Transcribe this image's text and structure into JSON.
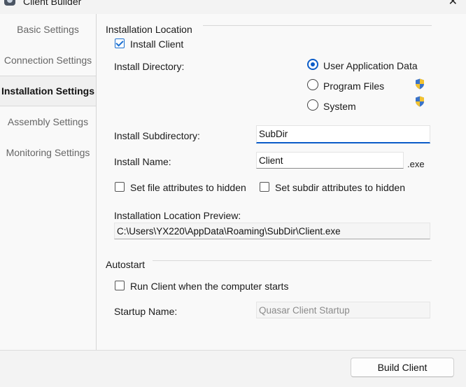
{
  "window": {
    "title": "Client Builder",
    "close_glyph": "✕"
  },
  "sidebar": {
    "items": [
      {
        "label": "Basic Settings"
      },
      {
        "label": "Connection Settings"
      },
      {
        "label": "Installation Settings",
        "active": true
      },
      {
        "label": "Assembly Settings"
      },
      {
        "label": "Monitoring Settings"
      }
    ]
  },
  "installation": {
    "group_title": "Installation Location",
    "install_client": {
      "label": "Install Client",
      "checked": true
    },
    "install_directory_label": "Install Directory:",
    "directory_options": [
      {
        "label": "User Application Data",
        "selected": true,
        "admin_shield": false
      },
      {
        "label": "Program Files",
        "selected": false,
        "admin_shield": true
      },
      {
        "label": "System",
        "selected": false,
        "admin_shield": true
      }
    ],
    "subdirectory": {
      "label": "Install Subdirectory:",
      "value": "SubDir"
    },
    "name": {
      "label": "Install Name:",
      "value": "Client",
      "suffix": ".exe"
    },
    "hide_file": {
      "label": "Set file attributes to hidden",
      "checked": false
    },
    "hide_subdir": {
      "label": "Set subdir attributes to hidden",
      "checked": false
    },
    "preview": {
      "label": "Installation Location Preview:",
      "value": "C:\\Users\\YX220\\AppData\\Roaming\\SubDir\\Client.exe"
    }
  },
  "autostart": {
    "group_title": "Autostart",
    "run_on_start": {
      "label": "Run Client when the computer starts",
      "checked": false
    },
    "startup_name": {
      "label": "Startup Name:",
      "value": "Quasar Client Startup"
    }
  },
  "footer": {
    "build_label": "Build Client"
  },
  "colors": {
    "accent": "#0b5cc8",
    "shield_blue": "#3a73c9",
    "shield_yellow": "#f2c230"
  }
}
